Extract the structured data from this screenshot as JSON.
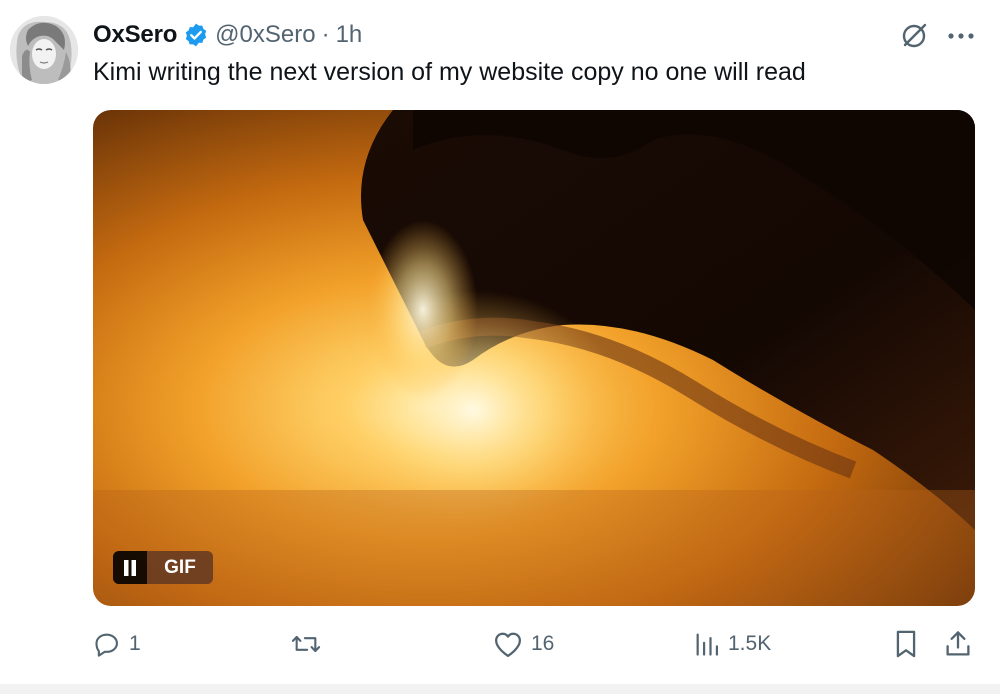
{
  "tweet": {
    "display_name": "OxSero",
    "handle": "@0xSero",
    "separator": "·",
    "time": "1h",
    "text": "Kimi writing the next version of my website copy no one will read",
    "verified_color": "#1d9bf0"
  },
  "media": {
    "type_label": "GIF",
    "pause_icon": "pause-icon"
  },
  "actions": {
    "reply_count": "1",
    "repost_count": "",
    "like_count": "16",
    "views_count": "1.5K"
  },
  "icons": {
    "grok": "grok-icon",
    "more": "more-icon",
    "reply": "reply-icon",
    "repost": "repost-icon",
    "like": "heart-icon",
    "views": "views-icon",
    "bookmark": "bookmark-icon",
    "share": "share-icon"
  },
  "colors": {
    "text": "#0f1419",
    "secondary": "#536471",
    "accent": "#1d9bf0"
  }
}
